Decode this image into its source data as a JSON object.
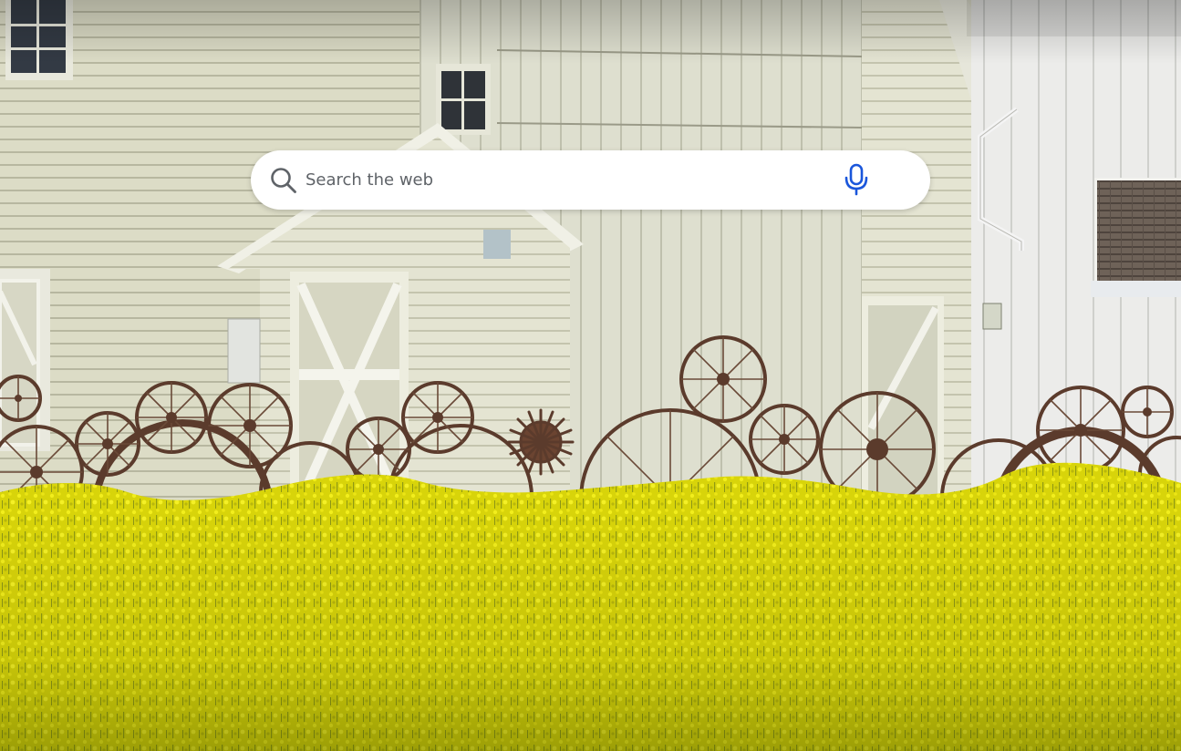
{
  "search": {
    "placeholder": "Search the web",
    "value": ""
  },
  "icons": {
    "search": "search-icon",
    "microphone": "microphone-icon"
  },
  "colors": {
    "accent": "#1a56db",
    "search_icon": "#5f6368",
    "search_bg": "#ffffff"
  }
}
